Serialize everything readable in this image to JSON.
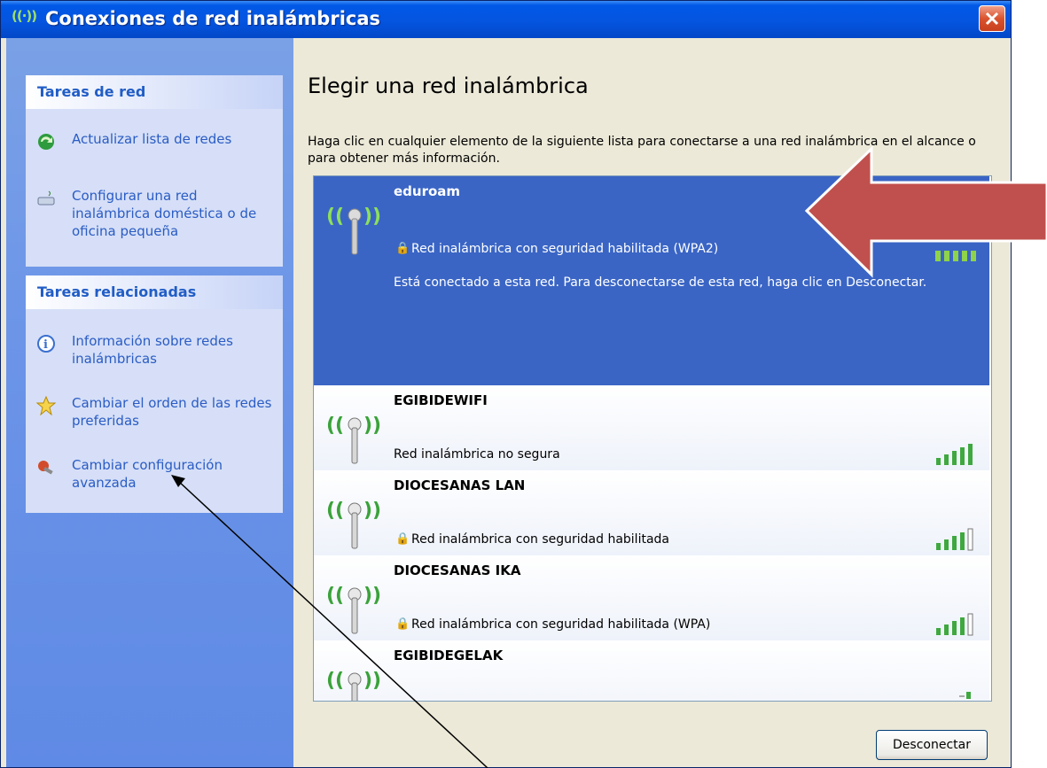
{
  "window": {
    "title": "Conexiones de red inalámbricas",
    "title_icon": "((·))"
  },
  "sidebar": {
    "network_tasks": {
      "header": "Tareas de red",
      "items": [
        {
          "label": "Actualizar lista de redes",
          "icon": "refresh-icon"
        },
        {
          "label": "Configurar una red inalámbrica doméstica o de oficina pequeña",
          "icon": "wizard-icon"
        }
      ]
    },
    "related_tasks": {
      "header": "Tareas relacionadas",
      "items": [
        {
          "label": "Información sobre redes inalámbricas",
          "icon": "info-icon"
        },
        {
          "label": "Cambiar el orden de las redes preferidas",
          "icon": "star-icon"
        },
        {
          "label": "Cambiar configuración avanzada",
          "icon": "settings-icon"
        }
      ]
    }
  },
  "main": {
    "heading": "Elegir una red inalámbrica",
    "instructions": "Haga clic en cualquier elemento de la siguiente lista para conectarse a una red inalámbrica en el alcance o para obtener más información.",
    "networks": [
      {
        "name": "eduroam",
        "status": "Red inalámbrica con seguridad habilitada (WPA2)",
        "secured": true,
        "selected": true,
        "signal_bars": 5,
        "detail": "Está conectado a esta red. Para desconectarse de esta red, haga clic en Desconectar."
      },
      {
        "name": "EGIBIDEWIFI",
        "status": "Red inalámbrica no segura",
        "secured": false,
        "selected": false,
        "signal_bars": 5
      },
      {
        "name": "DIOCESANAS LAN",
        "status": "Red inalámbrica con seguridad habilitada",
        "secured": true,
        "selected": false,
        "signal_bars": 4
      },
      {
        "name": "DIOCESANAS IKA",
        "status": "Red inalámbrica con seguridad habilitada (WPA)",
        "secured": true,
        "selected": false,
        "signal_bars": 4
      },
      {
        "name": "EGIBIDEGELAK",
        "status": "",
        "secured": false,
        "selected": false,
        "signal_bars": 1
      }
    ],
    "disconnect_button": "Desconectar"
  },
  "colors": {
    "titlebar": "#0058e6",
    "sidebar": "#6c95e8",
    "selected": "#3a65c5",
    "link": "#2a5cc4",
    "arrow": "#c0504d",
    "signal": "#3fa83f"
  }
}
